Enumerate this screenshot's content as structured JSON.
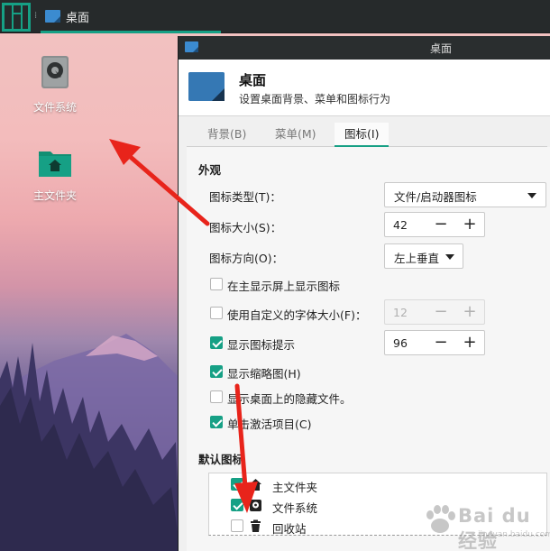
{
  "panel": {
    "taskbar_window_title": "桌面"
  },
  "desktop_icons": [
    {
      "label": "文件系统"
    },
    {
      "label": "主文件夹"
    }
  ],
  "window": {
    "title": "桌面",
    "header_title": "桌面",
    "header_subtitle": "设置桌面背景、菜单和图标行为"
  },
  "tabs": [
    {
      "label": "背景(B)",
      "active": false
    },
    {
      "label": "菜单(M)",
      "active": false
    },
    {
      "label": "图标(I)",
      "active": true
    }
  ],
  "appearance": {
    "section_title": "外观",
    "icon_type_label": "图标类型(T)：",
    "icon_type_value": "文件/启动器图标",
    "icon_size_label": "图标大小(S)：",
    "icon_size_value": "42",
    "icon_orientation_label": "图标方向(O)：",
    "icon_orientation_value": "左上垂直",
    "show_on_primary_label": "在主显示屏上显示图标",
    "show_on_primary_checked": false,
    "custom_font_label": "使用自定义的字体大小(F)：",
    "custom_font_checked": false,
    "custom_font_value": "12",
    "show_tooltips_label": "显示图标提示",
    "show_tooltips_checked": true,
    "tooltip_size_value": "96",
    "show_thumbnails_label": "显示缩略图(H)",
    "show_thumbnails_checked": true,
    "show_hidden_label": "显示桌面上的隐藏文件。",
    "show_hidden_checked": false,
    "single_click_label": "单击激活项目(C)",
    "single_click_checked": true
  },
  "default_icons": {
    "section_title": "默认图标",
    "items": [
      {
        "label": "主文件夹",
        "checked": true,
        "icon": "home-icon"
      },
      {
        "label": "文件系统",
        "checked": true,
        "icon": "drive-icon"
      },
      {
        "label": "回收站",
        "checked": false,
        "icon": "trash-icon"
      }
    ]
  },
  "watermark": {
    "text": "Bai du 经验",
    "sub": "jingyan.baidu.com"
  },
  "colors": {
    "accent": "#16a085",
    "panel": "#262a2b",
    "arrow": "#e8241b"
  }
}
